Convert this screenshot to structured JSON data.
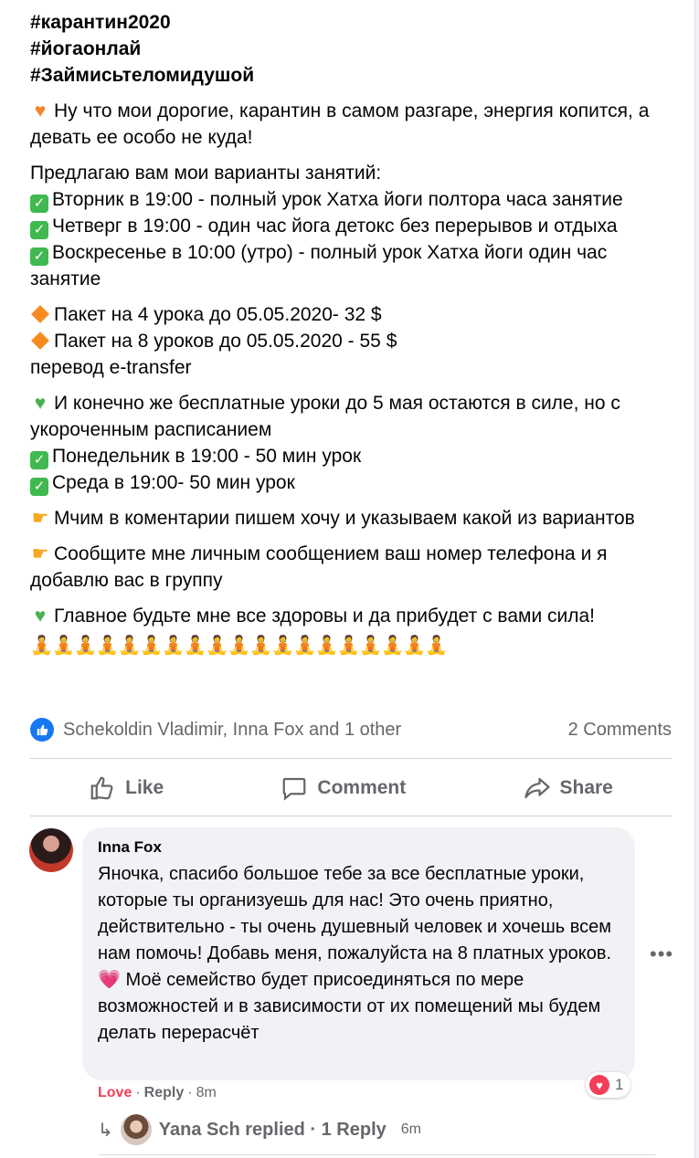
{
  "post": {
    "hashtags": [
      "#карантин2020",
      "#йогаонлай",
      "#Займисьтеломидушой"
    ],
    "intro": "Ну что мои дорогие, карантин в самом разгаре, энергия копится, а девать ее особо не куда!",
    "offer_heading": "Предлагаю вам мои варианты занятий:",
    "classes": [
      "Вторник в 19:00 - полный урок Хатха йоги полтора часа занятие",
      "Четверг в 19:00 - один час йога детокс без перерывов и отдыха",
      "Воскресенье в 10:00 (утро) - полный урок Хатха йоги один час занятие"
    ],
    "packages": [
      "Пакет на 4 урока до 05.05.2020- 32 $",
      "Пакет на 8 уроков до 05.05.2020 - 55 $"
    ],
    "transfer": "перевод e-transfer",
    "free_intro": "И конечно же бесплатные уроки до 5 мая остаются в силе, но с укороченным расписанием",
    "free_classes": [
      "Понедельник в 19:00 - 50 мин урок",
      "Среда в 19:00- 50 мин урок"
    ],
    "instruction_1": "Мчим в коментарии пишем хочу и указываем какой из вариантов",
    "instruction_2": "Сообщите мне личным сообщением ваш номер телефона и я добавлю вас в группу",
    "closing": "Главное будьте мне все здоровы и да прибудет с вами сила!",
    "yoga_emoji_count": 19
  },
  "reactions": {
    "names": "Schekoldin Vladimir, Inna Fox and 1 other",
    "comments_count": "2 Comments"
  },
  "actions": {
    "like": "Like",
    "comment": "Comment",
    "share": "Share"
  },
  "comment": {
    "author": "Inna Fox",
    "text_before_emoji": "Яночка, спасибо большое тебе за все бесплатные уроки, которые ты организуешь для нас! Это очень приятно, действительно - ты очень душевный человек и хочешь всем нам помочь! Добавь меня, пожалуйста на 8 платных уроков.",
    "text_after_emoji": "Моё семейство будет присоединяться по мере возможностей и в зависимости от их помещений мы будем делать перерасчёт",
    "love_label": "Love",
    "reply_label": "Reply",
    "time": "8m",
    "reaction_count": "1",
    "more": "•••"
  },
  "replies": {
    "text": "Yana Sch replied · 1 Reply",
    "time": "6m"
  },
  "colors": {
    "accent_blue": "#1877f2",
    "love_red": "#f33e58",
    "muted_text": "#65676b"
  }
}
